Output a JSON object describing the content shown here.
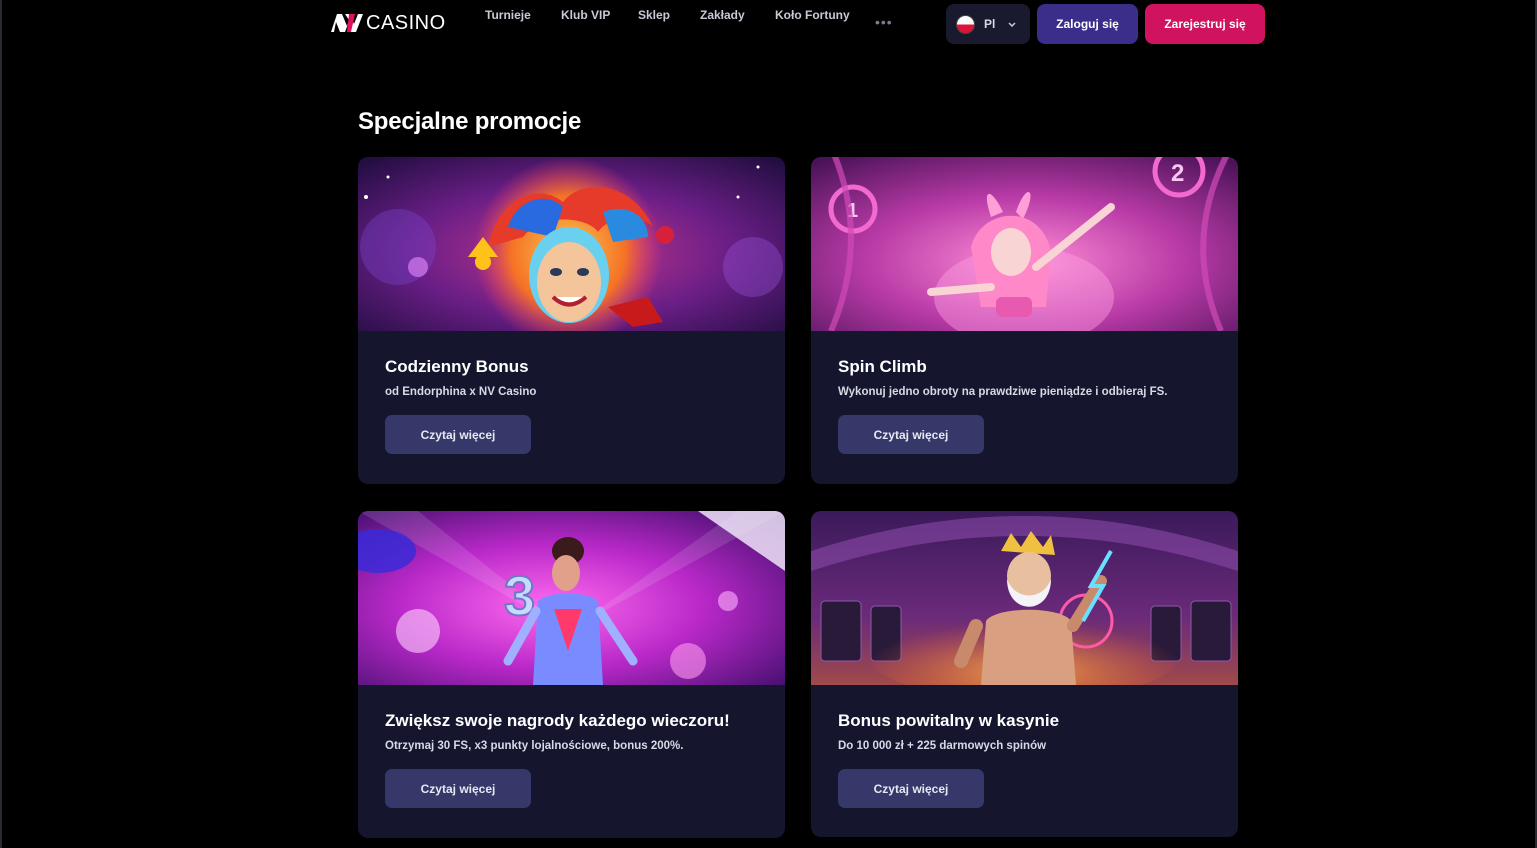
{
  "header": {
    "logo_text": "CASINO",
    "nav": [
      "Turnieje",
      "Klub VIP",
      "Sklep",
      "Zakłady",
      "Koło Fortuny"
    ],
    "more_label": "•••",
    "language": {
      "code": "Pl",
      "icon": "poland-flag-icon"
    },
    "login_label": "Zaloguj się",
    "register_label": "Zarejestruj się"
  },
  "section": {
    "title": "Specjalne promocje"
  },
  "cards": [
    {
      "title": "Codzienny Bonus",
      "subtitle": "od Endorphina x NV Casino",
      "button": "Czytaj więcej",
      "image": "jester-slot-illustration"
    },
    {
      "title": "Spin Climb",
      "subtitle": "Wykonuj jedno obroty na prawdziwe pieniądze i odbieraj FS.",
      "button": "Czytaj więcej",
      "image": "bunny-girl-illustration"
    },
    {
      "title": "Zwiększ swoje nagrody każdego wieczoru!",
      "subtitle": "Otrzymaj 30 FS, x3 punkty lojalnościowe, bonus 200%.",
      "button": "Czytaj więcej",
      "image": "neon-dancer-illustration"
    },
    {
      "title": "Bonus powitalny w kasynie",
      "subtitle": "Do 10 000 zł + 225 darmowych spinów",
      "button": "Czytaj więcej",
      "image": "zeus-casino-illustration"
    }
  ],
  "colors": {
    "background": "#000000",
    "card": "#15152d",
    "card_button": "#353869",
    "login": "#3a2e8a",
    "register": "#d1125f"
  }
}
